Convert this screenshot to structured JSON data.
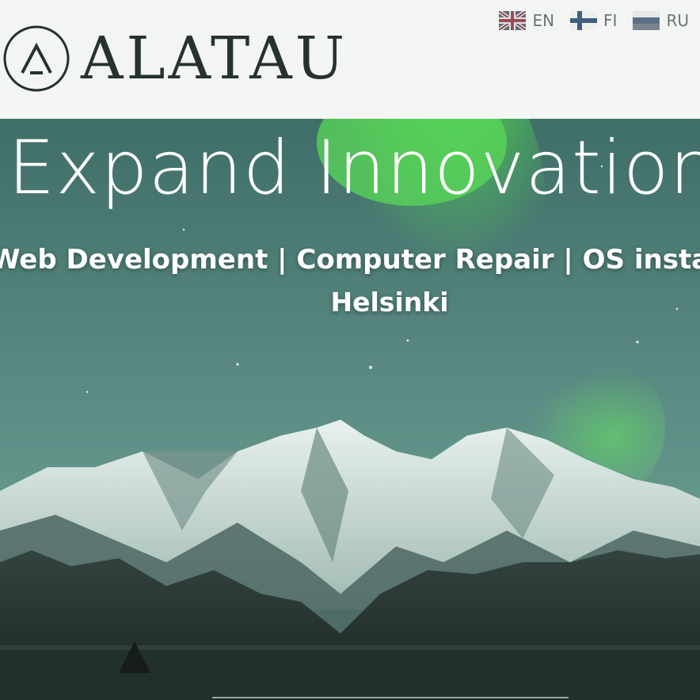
{
  "header": {
    "brand": "ALATAU",
    "languages": [
      {
        "code": "EN",
        "flag": "uk-flag-icon"
      },
      {
        "code": "FI",
        "flag": "finland-flag-icon"
      },
      {
        "code": "RU",
        "flag": "russia-flag-icon"
      }
    ]
  },
  "hero": {
    "title": "Expand Innovation",
    "subtitle": "Web Development | Computer Repair | OS installation",
    "city": "Helsinki"
  },
  "colors": {
    "header_bg": "#f3f5f2",
    "brand_text": "#253230",
    "aurora_green": "#5bd65a",
    "sky_teal": "#5f8b84",
    "forest_dark": "#1e2826"
  }
}
